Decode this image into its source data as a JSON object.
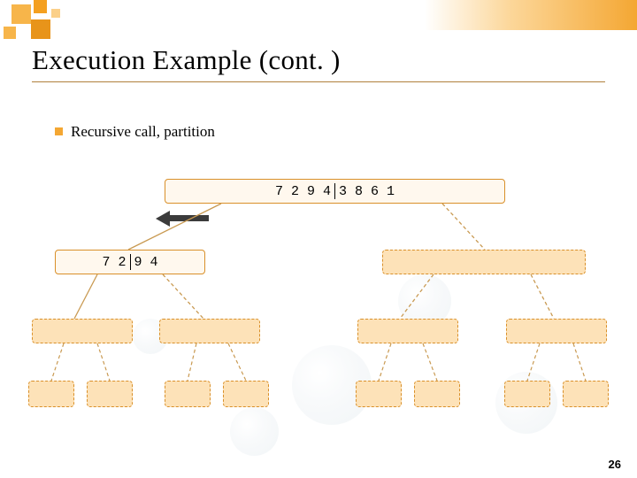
{
  "title": "Execution Example (cont. )",
  "bullet_text": "Recursive call, partition",
  "root": {
    "left": "7 2 9 4",
    "right": "3 8 6 1"
  },
  "level2_left": {
    "left": "7 2",
    "right": "9 4"
  },
  "page_number": "26"
}
